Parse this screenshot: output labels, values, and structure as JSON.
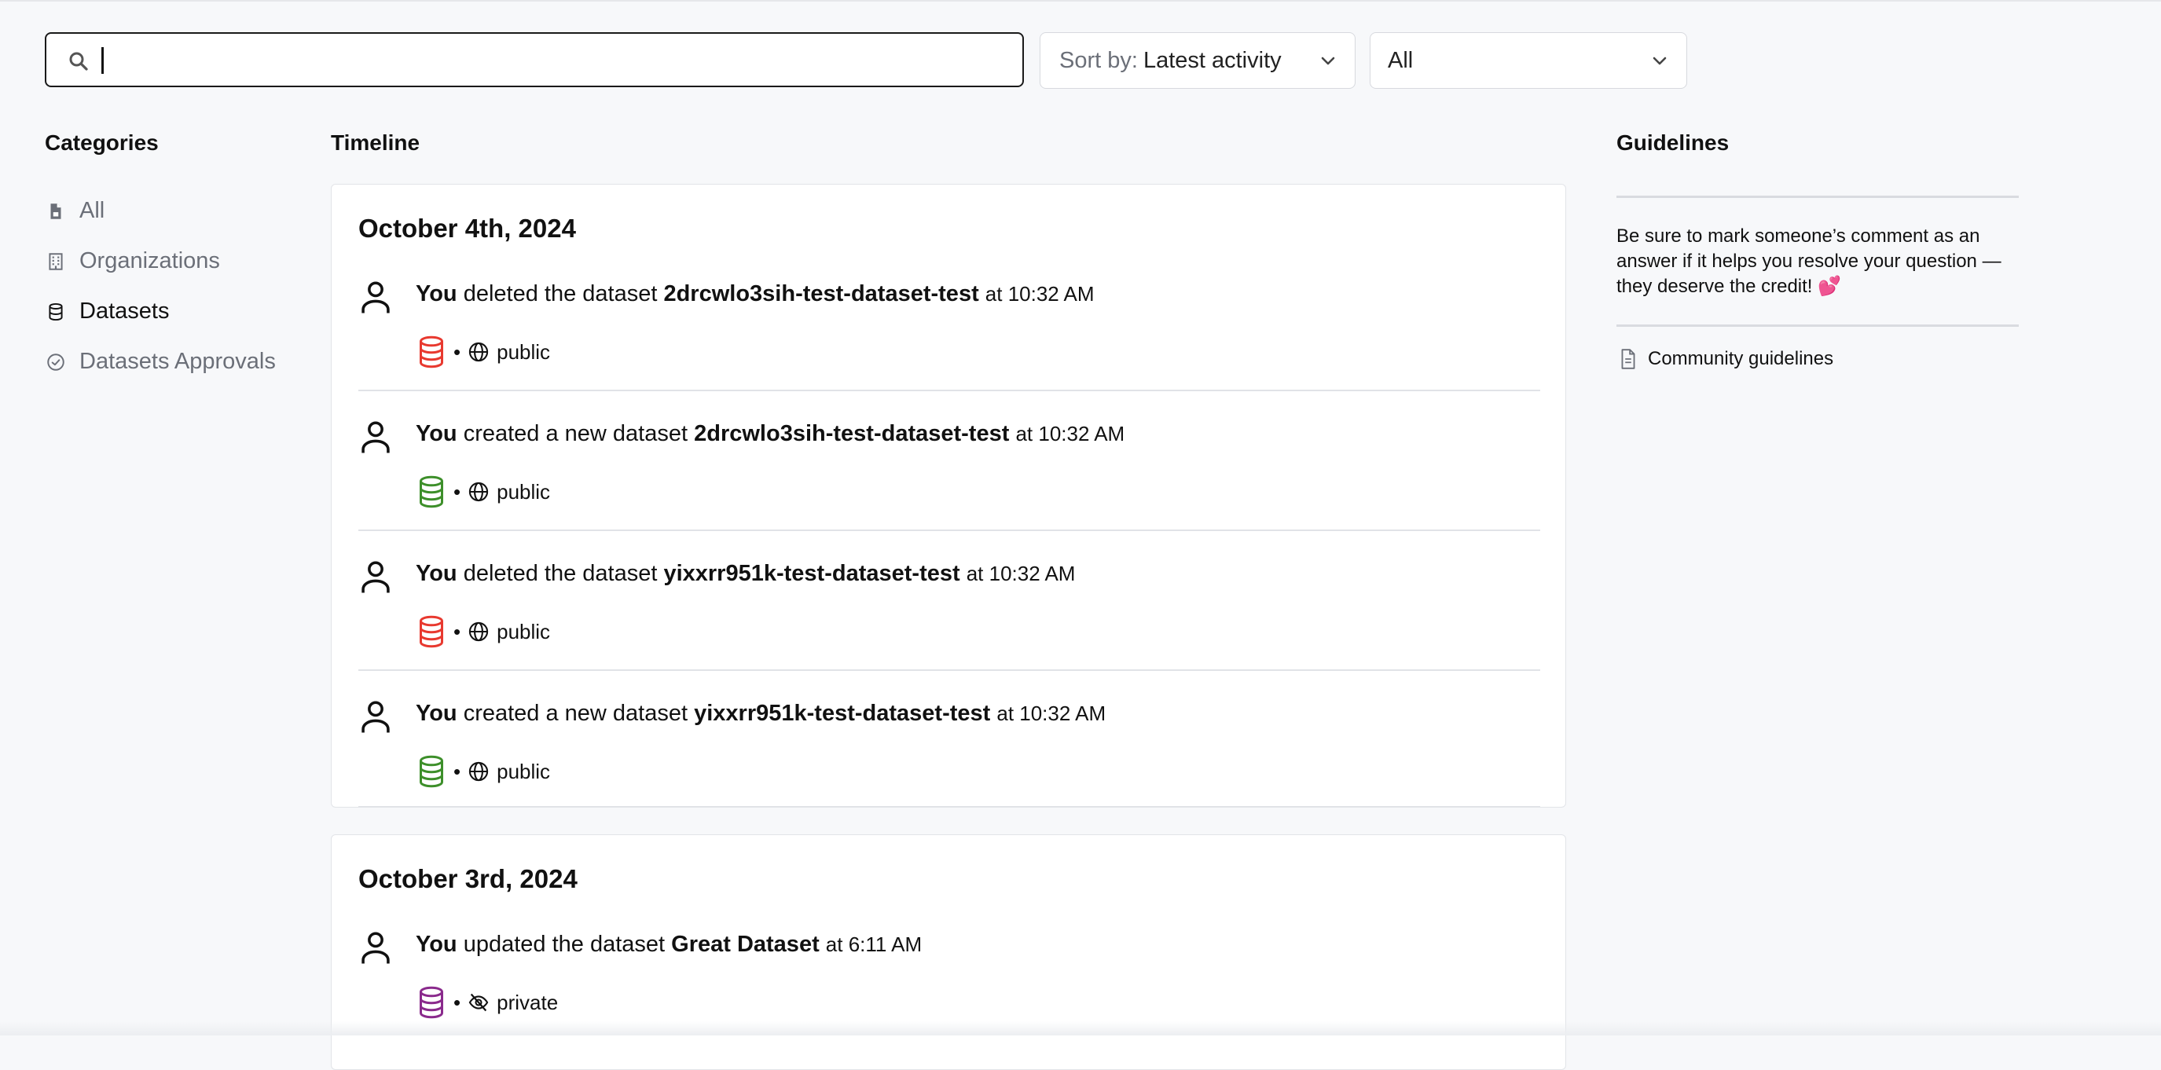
{
  "search": {
    "value": ""
  },
  "sort": {
    "prefix": "Sort by:",
    "value": "Latest activity"
  },
  "filter": {
    "value": "All"
  },
  "categories": {
    "heading": "Categories",
    "items": [
      {
        "label": "All",
        "icon": "file-icon",
        "active": false
      },
      {
        "label": "Organizations",
        "icon": "building-icon",
        "active": false
      },
      {
        "label": "Datasets",
        "icon": "database-icon",
        "active": true
      },
      {
        "label": "Datasets Approvals",
        "icon": "check-circle-icon",
        "active": false
      }
    ]
  },
  "timeline": {
    "heading": "Timeline",
    "days": [
      {
        "date": "October 4th, 2024",
        "entries": [
          {
            "actor": "You",
            "action": "deleted the dataset",
            "target": "2drcwlo3sih-test-dataset-test",
            "time": "at 10:32 AM",
            "db_color": "#e8392f",
            "visibility": "public",
            "visibility_icon": "globe-icon"
          },
          {
            "actor": "You",
            "action": "created a new dataset",
            "target": "2drcwlo3sih-test-dataset-test",
            "time": "at 10:32 AM",
            "db_color": "#3d8f2a",
            "visibility": "public",
            "visibility_icon": "globe-icon"
          },
          {
            "actor": "You",
            "action": "deleted the dataset",
            "target": "yixxrr951k-test-dataset-test",
            "time": "at 10:32 AM",
            "db_color": "#e8392f",
            "visibility": "public",
            "visibility_icon": "globe-icon"
          },
          {
            "actor": "You",
            "action": "created a new dataset",
            "target": "yixxrr951k-test-dataset-test",
            "time": "at 10:32 AM",
            "db_color": "#3d8f2a",
            "visibility": "public",
            "visibility_icon": "globe-icon"
          }
        ]
      },
      {
        "date": "October 3rd, 2024",
        "entries": [
          {
            "actor": "You",
            "action": "updated the dataset",
            "target": "Great Dataset",
            "time": "at 6:11 AM",
            "db_color": "#8a2a8c",
            "visibility": "private",
            "visibility_icon": "eye-off-icon"
          }
        ]
      }
    ]
  },
  "guidelines": {
    "heading": "Guidelines",
    "text": "Be sure to mark someone’s comment as an answer if it helps you resolve your question — they deserve the credit! 💕",
    "link": "Community guidelines"
  }
}
